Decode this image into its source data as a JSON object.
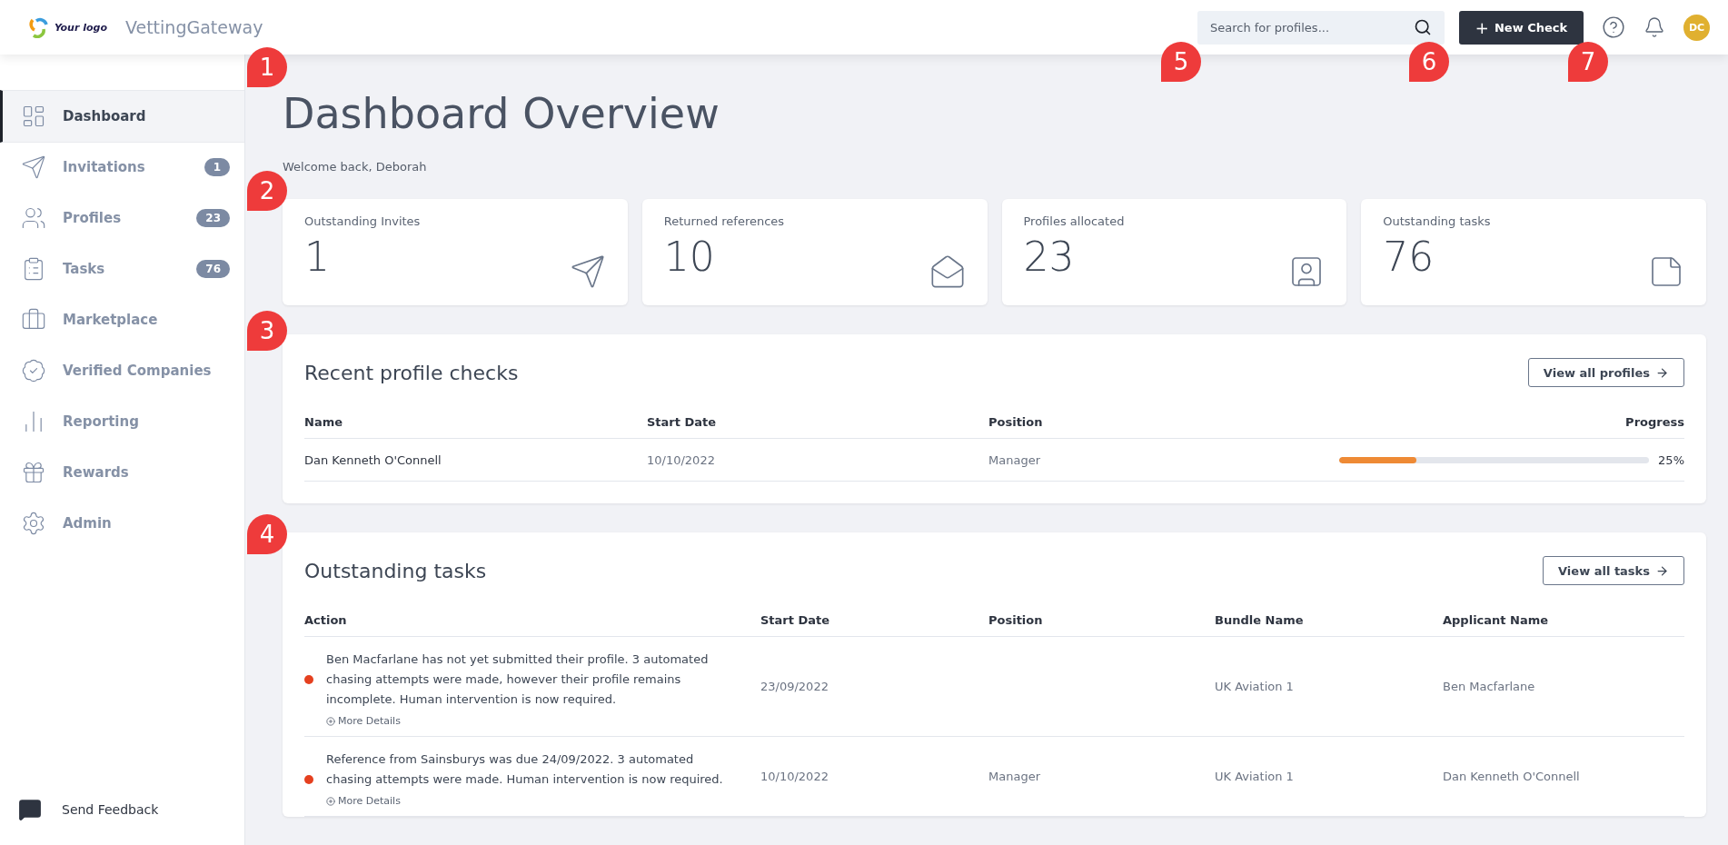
{
  "header": {
    "logo_text": "Your logo",
    "app_name": "VettingGateway",
    "search": {
      "placeholder": "Search for profiles..."
    },
    "new_button": {
      "icon": "+",
      "label": "New Check"
    },
    "avatar": "DC"
  },
  "sidebar": {
    "items": [
      {
        "label": "Dashboard",
        "selected": true
      },
      {
        "label": "Invitations",
        "selected": false,
        "badge": "1"
      },
      {
        "label": "Profiles",
        "selected": false,
        "badge": "23"
      },
      {
        "label": "Tasks",
        "selected": false,
        "badge": "76"
      },
      {
        "label": "Marketplace",
        "selected": false
      },
      {
        "label": "Verified Companies",
        "selected": false
      },
      {
        "label": "Reporting",
        "selected": false
      },
      {
        "label": "Rewards",
        "selected": false
      },
      {
        "label": "Admin",
        "selected": false
      }
    ],
    "feedback": "Send Feedback"
  },
  "page": {
    "title": "Dashboard Overview",
    "welcome": "Welcome back, Deborah"
  },
  "stats": [
    {
      "label": "Outstanding Invites",
      "value": "1"
    },
    {
      "label": "Returned references",
      "value": "10"
    },
    {
      "label": "Profiles allocated",
      "value": "23"
    },
    {
      "label": "Outstanding tasks",
      "value": "76"
    }
  ],
  "recent_checks": {
    "title": "Recent profile checks",
    "button": "View all profiles",
    "columns": [
      "Name",
      "Start Date",
      "Position",
      "Progress"
    ],
    "rows": [
      {
        "name": "Dan Kenneth O'Connell",
        "start_date": "10/10/2022",
        "position": "Manager",
        "level": 0.25,
        "progress": "25%"
      }
    ]
  },
  "outstanding_tasks": {
    "title": "Outstanding tasks",
    "button": "View all tasks",
    "columns": [
      "Action",
      "Start Date",
      "Position",
      "Bundle Name",
      "Applicant Name"
    ],
    "rows": [
      {
        "color": "#e5401f",
        "action": "Ben Macfarlane has not yet submitted their profile. 3 automated chasing attempts were made, however their profile remains incomplete. Human intervention is now required.",
        "details": "More Details",
        "start_date": "23/09/2022",
        "bundle": "UK Aviation 1",
        "applicant": "Ben Macfarlane"
      },
      {
        "color": "#e5401f",
        "action": "Reference from Sainsburys was due 24/09/2022. 3 automated chasing attempts were made. Human intervention is now required.",
        "details": "More Details",
        "start_date": "10/10/2022",
        "position": "Manager",
        "bundle": "UK Aviation 1",
        "applicant": "Dan Kenneth O'Connell"
      }
    ]
  },
  "callouts": [
    "1",
    "2",
    "3",
    "4",
    "5",
    "6",
    "7"
  ]
}
